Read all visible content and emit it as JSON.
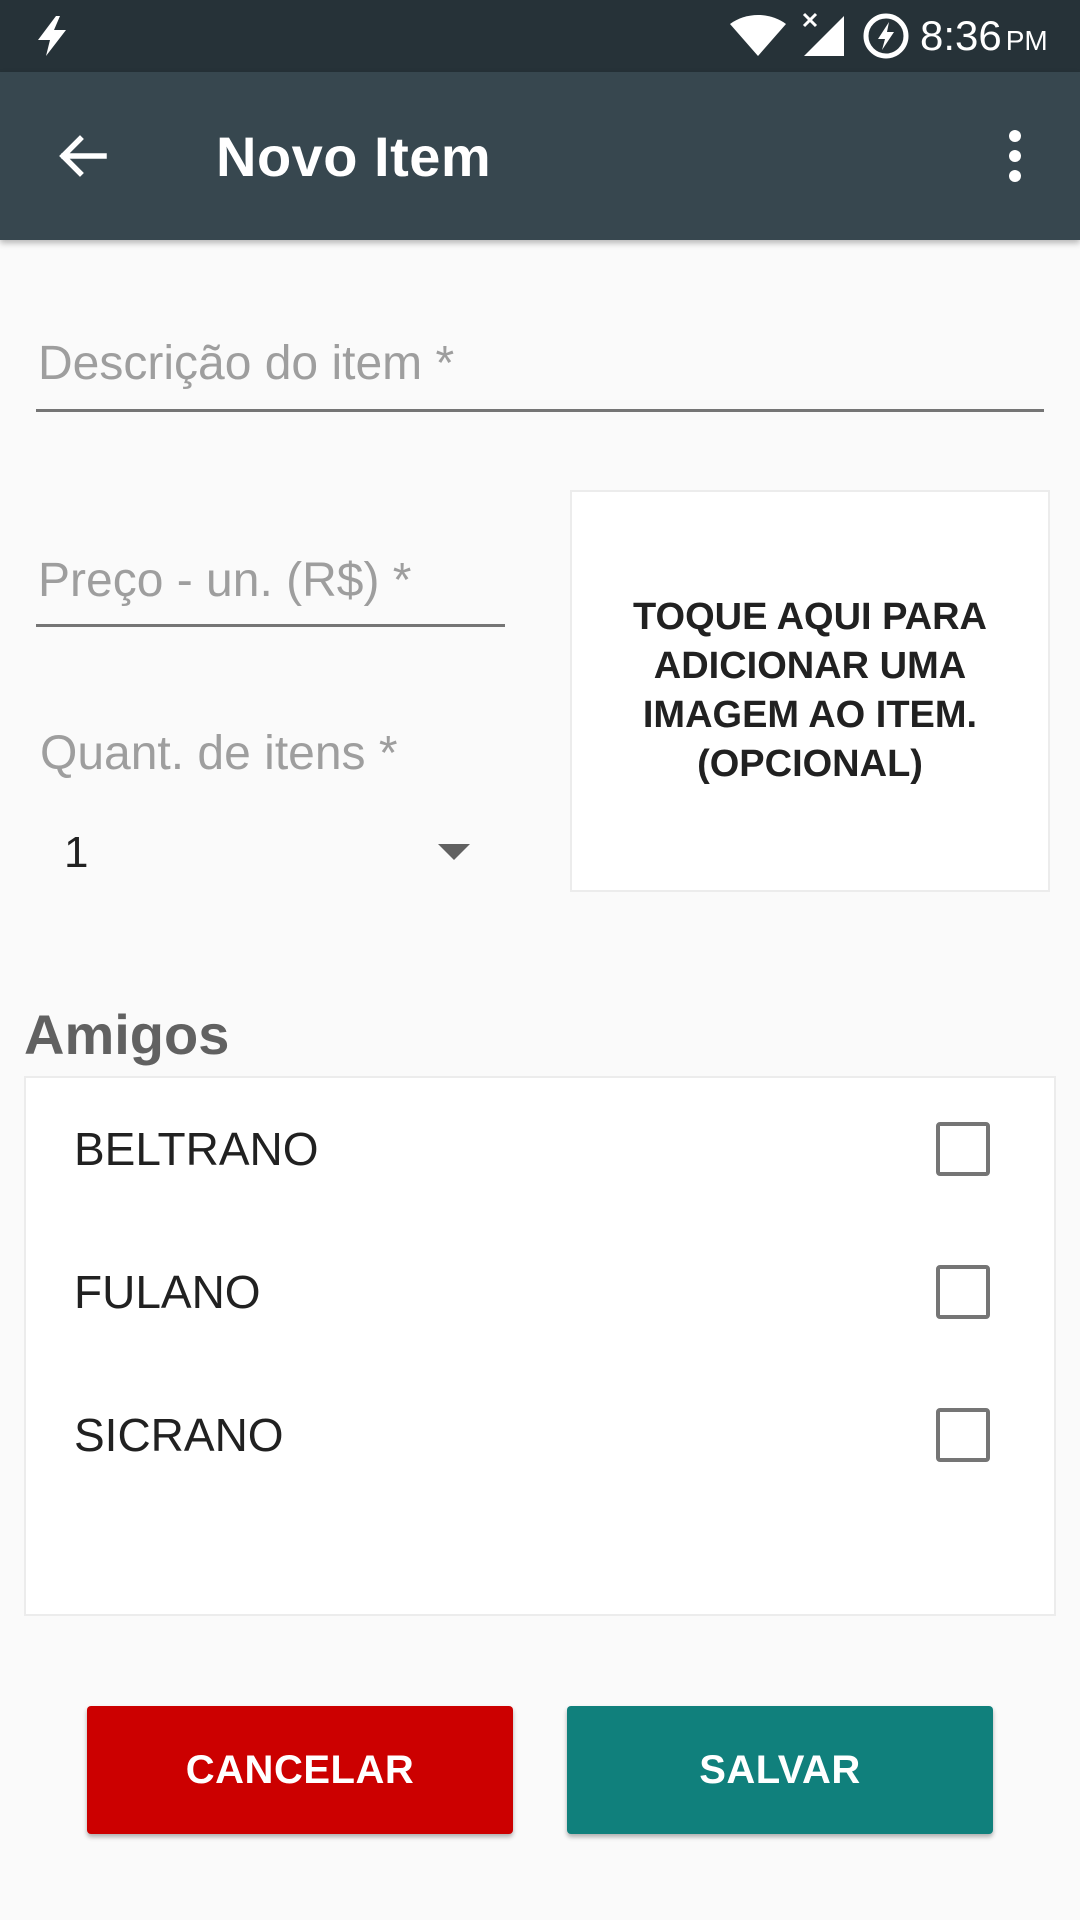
{
  "status_bar": {
    "time": "8:36",
    "ampm": "PM",
    "icons": [
      "flash-icon",
      "wifi-icon",
      "signal-no-data-icon",
      "battery-charging-icon"
    ]
  },
  "app_bar": {
    "title": "Novo Item",
    "back_icon": "arrow-back-icon",
    "menu_icon": "more-vertical-icon"
  },
  "form": {
    "description_placeholder": "Descrição do item *",
    "price_placeholder": "Preço - un. (R$) *",
    "quantity_label": "Quant. de itens *",
    "quantity_value": "1"
  },
  "image_box": {
    "text": "TOQUE AQUI PARA ADICIONAR UMA IMAGEM AO ITEM. (OPCIONAL)"
  },
  "friends": {
    "title": "Amigos",
    "items": [
      {
        "name": "BELTRANO",
        "checked": false
      },
      {
        "name": "FULANO",
        "checked": false
      },
      {
        "name": "SICRANO",
        "checked": false
      }
    ]
  },
  "buttons": {
    "cancel_label": "CANCELAR",
    "save_label": "SALVAR"
  },
  "colors": {
    "status_bar": "#263238",
    "app_bar": "#37474f",
    "cancel": "#cc0000",
    "save": "#10807c"
  }
}
